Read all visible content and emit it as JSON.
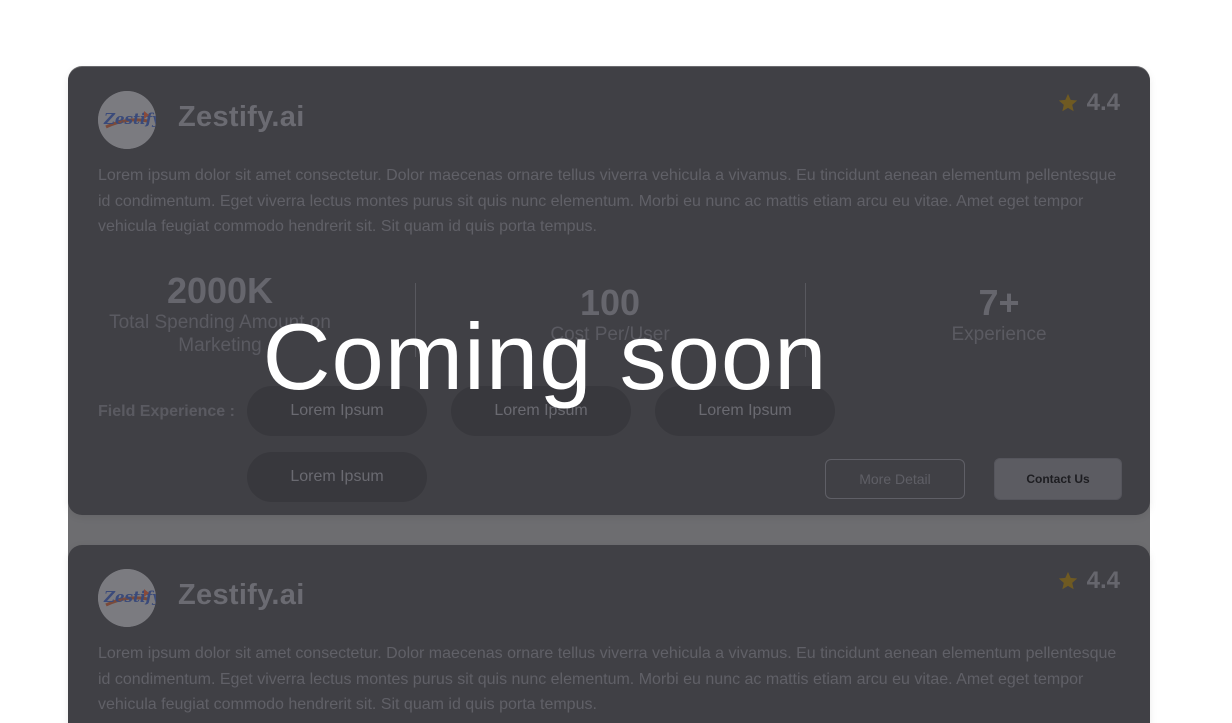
{
  "cards": [
    {
      "logo_text": "Zestify",
      "name": "Zestify.ai",
      "rating": "4.4",
      "description": "Lorem ipsum dolor sit amet consectetur. Dolor maecenas ornare tellus viverra vehicula a vivamus. Eu tincidunt aenean elementum pellentesque id condimentum. Eget viverra lectus montes purus sit quis nunc elementum. Morbi eu nunc ac mattis etiam arcu eu vitae. Amet eget tempor vehicula feugiat commodo hendrerit sit. Sit quam id quis porta tempus.",
      "stats": [
        {
          "value": "2000K",
          "label": "Total Spending Amount on Marketing"
        },
        {
          "value": "100",
          "label": "Cost Per/User"
        },
        {
          "value": "7+",
          "label": "Experience"
        }
      ],
      "field_experience_label": "Field Experience :",
      "chips": [
        "Lorem Ipsum",
        "Lorem Ipsum",
        "Lorem Ipsum",
        "Lorem Ipsum"
      ],
      "more_detail_label": "More Detail",
      "contact_label": "Contact Us"
    },
    {
      "logo_text": "Zestify",
      "name": "Zestify.ai",
      "rating": "4.4",
      "description": "Lorem ipsum dolor sit amet consectetur. Dolor maecenas ornare tellus viverra vehicula a vivamus. Eu tincidunt aenean elementum pellentesque id condimentum. Eget viverra lectus montes purus sit quis nunc elementum. Morbi eu nunc ac mattis etiam arcu eu vitae. Amet eget tempor vehicula feugiat commodo hendrerit sit. Sit quam id quis porta tempus."
    }
  ],
  "overlay": {
    "text": "Coming soon"
  },
  "colors": {
    "overlay_card": "#404045",
    "star": "#b8860b"
  },
  "icons": {
    "star": "star-icon",
    "logo": "zestify-logo"
  }
}
